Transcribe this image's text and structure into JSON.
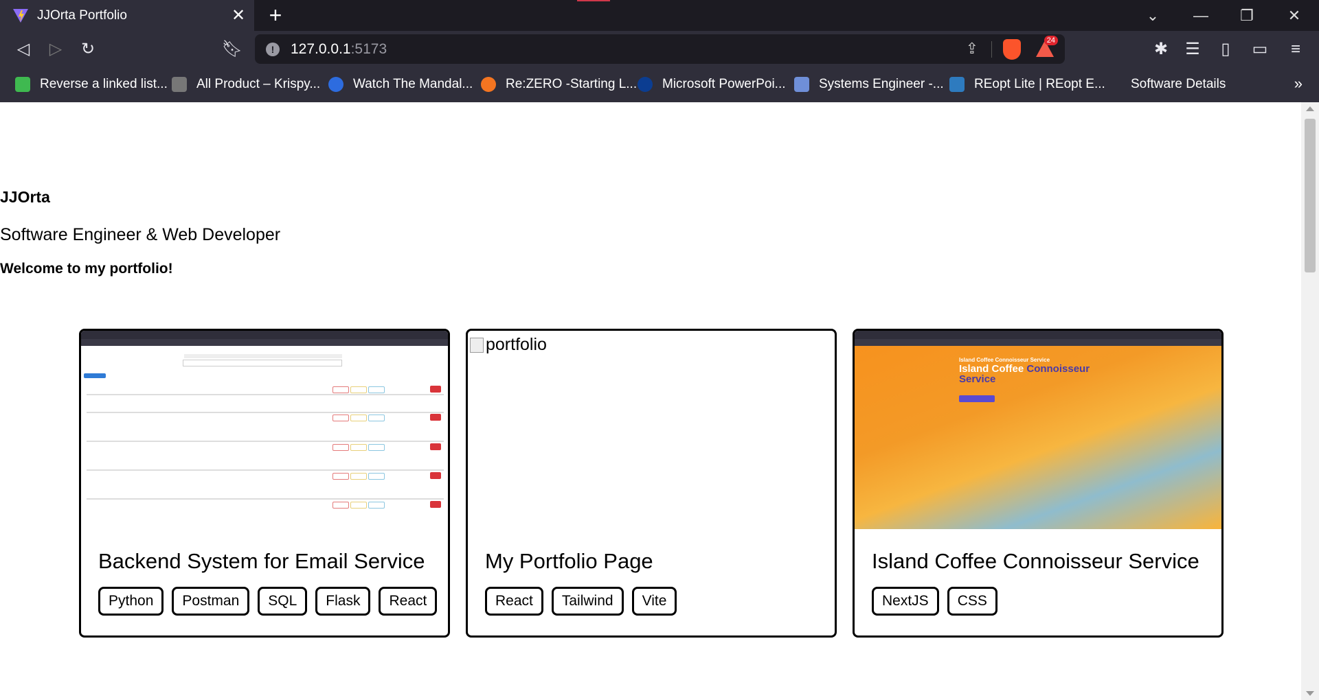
{
  "browser": {
    "tab_title": "JJOrta Portfolio",
    "url_host": "127.0.0.1",
    "url_port": ":5173",
    "rewards_badge": "24",
    "bookmarks": [
      {
        "label": "Reverse a linked list...",
        "icon": "linked-list-icon",
        "color": "#3fb950"
      },
      {
        "label": "All Product – Krispy...",
        "icon": "krispy-icon",
        "color": "#777777"
      },
      {
        "label": "Watch The Mandal...",
        "icon": "play-icon",
        "color": "#2d6cdf"
      },
      {
        "label": "Re:ZERO -Starting L...",
        "icon": "crunchyroll-icon",
        "color": "#f47521"
      },
      {
        "label": "Microsoft PowerPoi...",
        "icon": "nasa-icon",
        "color": "#0b3d91"
      },
      {
        "label": "Systems Engineer -...",
        "icon": "systems-icon",
        "color": "#6f8fd8"
      },
      {
        "label": "REopt Lite | REopt E...",
        "icon": "reopt-icon",
        "color": "#2e7bbf"
      },
      {
        "label": "Software Details",
        "icon": "",
        "color": ""
      }
    ]
  },
  "hero": {
    "name": "JJOrta",
    "role": "Software Engineer & Web Developer",
    "welcome": "Welcome to my portfolio!"
  },
  "projects": [
    {
      "title": "Backend System for Email Service",
      "tags": [
        "Python",
        "Postman",
        "SQL",
        "Flask",
        "React"
      ]
    },
    {
      "title": "My Portfolio Page",
      "image_alt": "portfolio",
      "tags": [
        "React",
        "Tailwind",
        "Vite"
      ]
    },
    {
      "title": "Island Coffee Connoisseur Service",
      "preview_sub": "Island Coffee Connoisseur Service",
      "preview_title_1": "Island Coffee ",
      "preview_title_2": "Connoisseur",
      "preview_title_3": "Service",
      "tags": [
        "NextJS",
        "CSS"
      ]
    }
  ]
}
